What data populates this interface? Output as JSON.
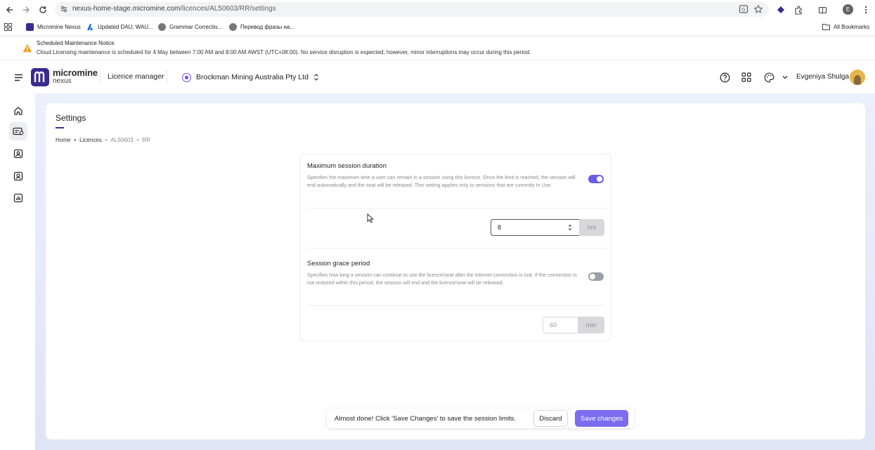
{
  "browser": {
    "url_host": "nexus-home-stage.micromine.com",
    "url_path": "/licences/AL50603/RR/settings",
    "bookmarks": [
      {
        "label": "Micromine Nexus",
        "color": "#3b2a8f"
      },
      {
        "label": "Updated DAU, WAU...",
        "color": "#1a5fc7"
      },
      {
        "label": "Grammar Correctio...",
        "color": "#777777"
      },
      {
        "label": "Перевод фразы на...",
        "color": "#777777"
      }
    ],
    "all_bookmarks": "All Bookmarks",
    "profile_initial": "E"
  },
  "notice": {
    "title": "Scheduled Maintenance Notice",
    "body": "Cloud Licensing maintenance is scheduled for 4 May between 7:00 AM and 8:00 AM AWST (UTC+08:00). No service disruption is expected; however, minor interruptions may occur during this period."
  },
  "header": {
    "logo_line1": "micromine",
    "logo_line2": "nexus",
    "app_name": "Licence manager",
    "org_name": "Brockman Mining Australia Pty Ltd",
    "user_name": "Evgeniya Shulga"
  },
  "page": {
    "title": "Settings",
    "breadcrumb": [
      "Home",
      "Licences",
      "AL50603",
      "RR"
    ]
  },
  "settings": {
    "max_session": {
      "title": "Maximum session duration",
      "description": "Specifies the maximum time a user can remain in a session using this licence. Once the limit is reached, the session will end automatically and the seat will be released. This setting applies only to sessions that are currently In Use.",
      "enabled": true,
      "value": "8",
      "unit": "hrs"
    },
    "grace_period": {
      "title": "Session grace period",
      "description": "Specifies how long a session can continue to use the licence/seat after the internet connection is lost. If the connection is not restored within this period, the session will end and the licence/seat will be released.",
      "enabled": false,
      "value": "60",
      "unit": "min"
    }
  },
  "toast": {
    "message": "Almost done! Click 'Save Changes' to save the session limits.",
    "discard_label": "Discard",
    "save_label": "Save changes"
  },
  "colors": {
    "accent": "#7b6cf0",
    "brand": "#3b2a8f",
    "toggle_on": "#6b5ce7",
    "warning": "#f2a22c"
  }
}
